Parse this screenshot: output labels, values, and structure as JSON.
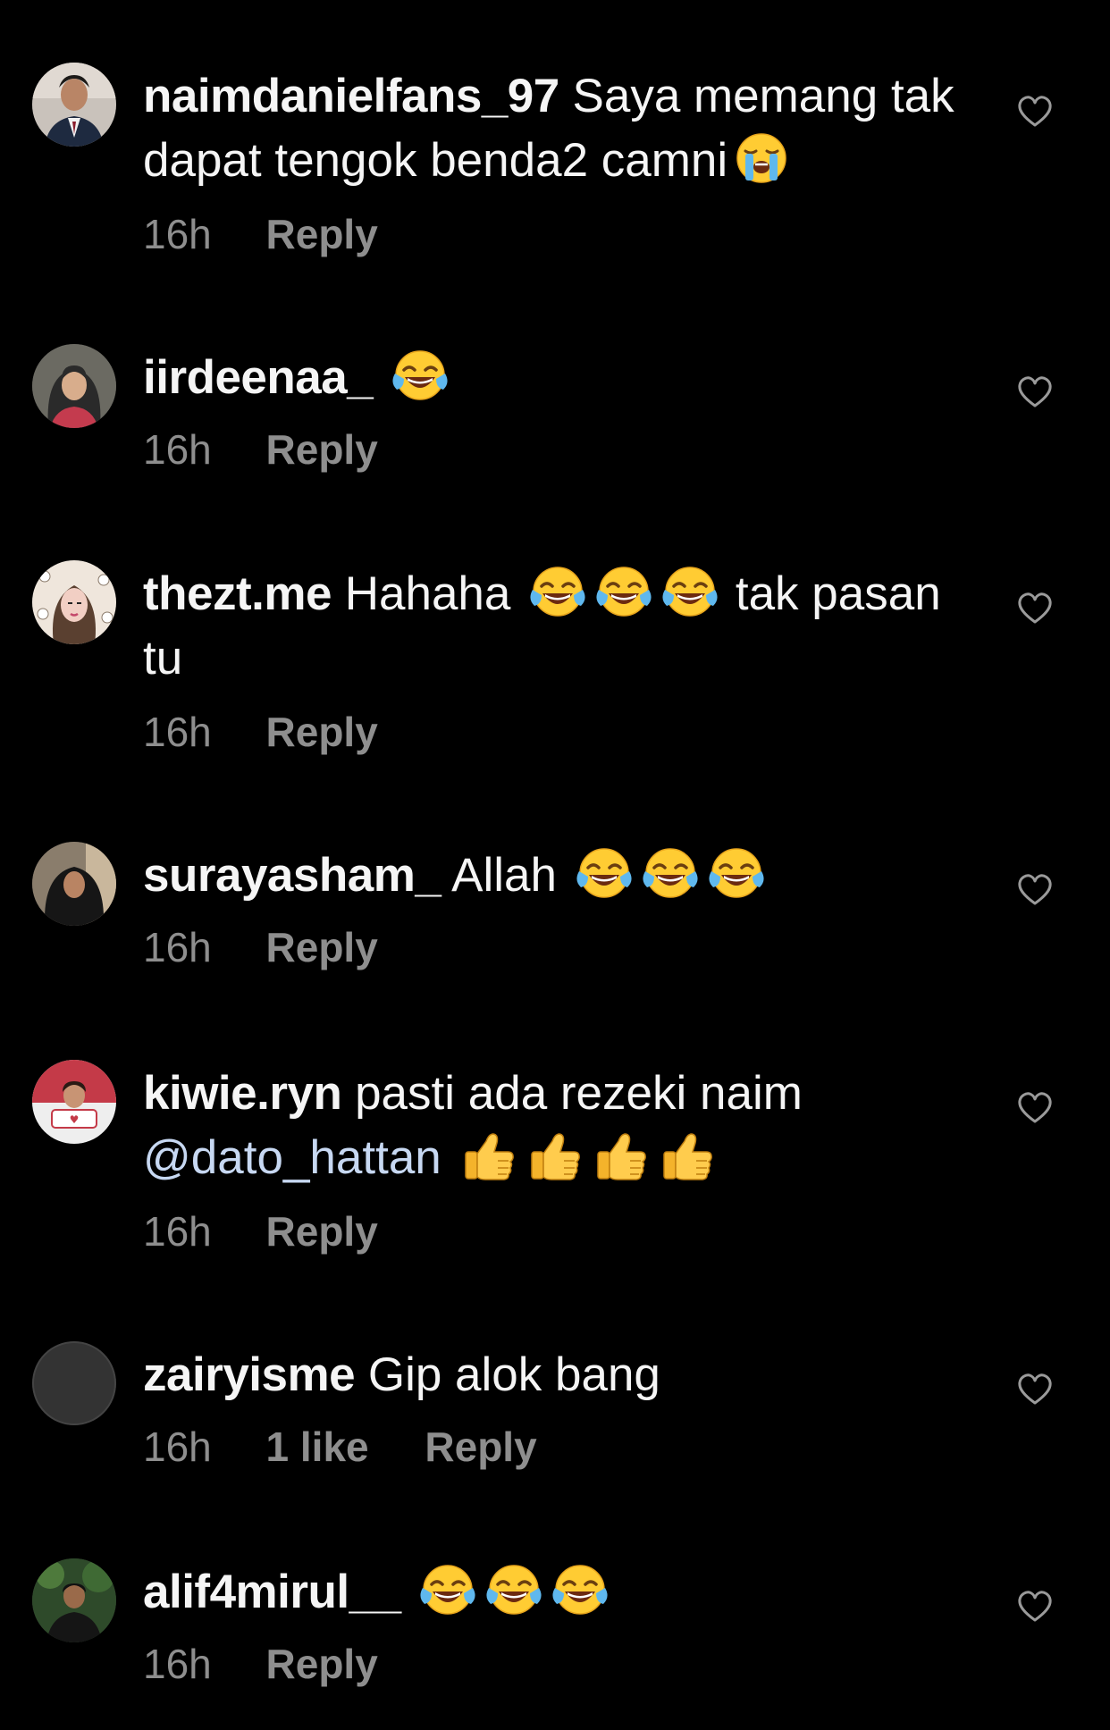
{
  "colors": {
    "background": "#000000",
    "text": "#f5f5f5",
    "meta": "#8e8e8e",
    "mention": "#c7d8f2",
    "heart_outline": "#9a9a9a"
  },
  "reply_label": "Reply",
  "comments": [
    {
      "username": "naimdanielfans_97",
      "text": "Saya memang tak dapat tengok benda2 camni",
      "emojis": [
        "loudly-crying-face"
      ],
      "time": "16h",
      "likes": "",
      "avatar": "profile-photo-man-suit"
    },
    {
      "username": "iirdeenaa_",
      "text": "",
      "emojis": [
        "face-with-tears-of-joy"
      ],
      "time": "16h",
      "likes": "",
      "avatar": "profile-photo-woman-hijab"
    },
    {
      "username": "thezt.me",
      "text_before": "Hahaha",
      "emojis": [
        "face-with-tears-of-joy",
        "face-with-tears-of-joy",
        "face-with-tears-of-joy"
      ],
      "text_after": "tak pasan tu",
      "time": "16h",
      "likes": "",
      "avatar": "profile-illustration-woman"
    },
    {
      "username": "surayasham_",
      "text": "Allah",
      "emojis": [
        "face-with-tears-of-joy",
        "face-with-tears-of-joy",
        "face-with-tears-of-joy"
      ],
      "time": "16h",
      "likes": "",
      "avatar": "profile-photo-woman-dark"
    },
    {
      "username": "kiwie.ryn",
      "text": "pasti ada rezeki naim",
      "mention": "@dato_hattan",
      "emojis": [
        "thumbs-up",
        "thumbs-up",
        "thumbs-up",
        "thumbs-up"
      ],
      "time": "16h",
      "likes": "",
      "avatar": "profile-photo-woman-red"
    },
    {
      "username": "zairyisme",
      "text": "Gip alok bang",
      "emojis": [],
      "time": "16h",
      "likes": "1 like",
      "avatar": "default-avatar"
    },
    {
      "username": "alif4mirul__",
      "text": "",
      "emojis": [
        "face-with-tears-of-joy",
        "face-with-tears-of-joy",
        "face-with-tears-of-joy"
      ],
      "time": "16h",
      "likes": "",
      "avatar": "profile-photo-man-forest"
    }
  ]
}
